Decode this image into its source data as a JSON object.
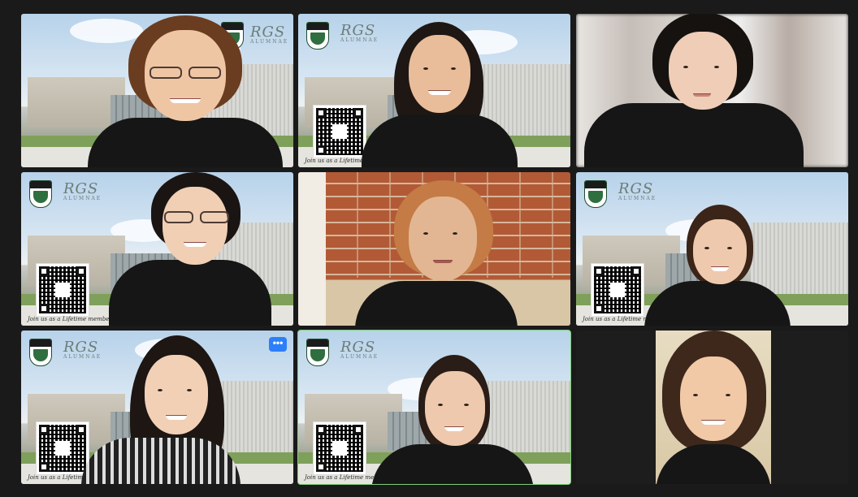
{
  "meeting": {
    "layout": "gallery-view",
    "active_speaker_tile": 8,
    "accent_active_color": "#7ed07a",
    "more_options_color": "#2d7ff9"
  },
  "branding": {
    "logo_text": "RGS",
    "logo_subtext": "ALUMNAE",
    "caption": "Join us as a Lifetime member!"
  },
  "tiles": [
    {
      "background": "school",
      "has_qr": false
    },
    {
      "background": "school",
      "has_qr": true
    },
    {
      "background": "blurred-room",
      "has_qr": false
    },
    {
      "background": "school",
      "has_qr": true
    },
    {
      "background": "brick-wall",
      "has_qr": false
    },
    {
      "background": "school",
      "has_qr": true
    },
    {
      "background": "school",
      "has_qr": true,
      "has_more_button": true
    },
    {
      "background": "school",
      "has_qr": true,
      "active": true
    },
    {
      "background": "plain-room",
      "has_qr": false
    }
  ],
  "more_button_label": "•••"
}
